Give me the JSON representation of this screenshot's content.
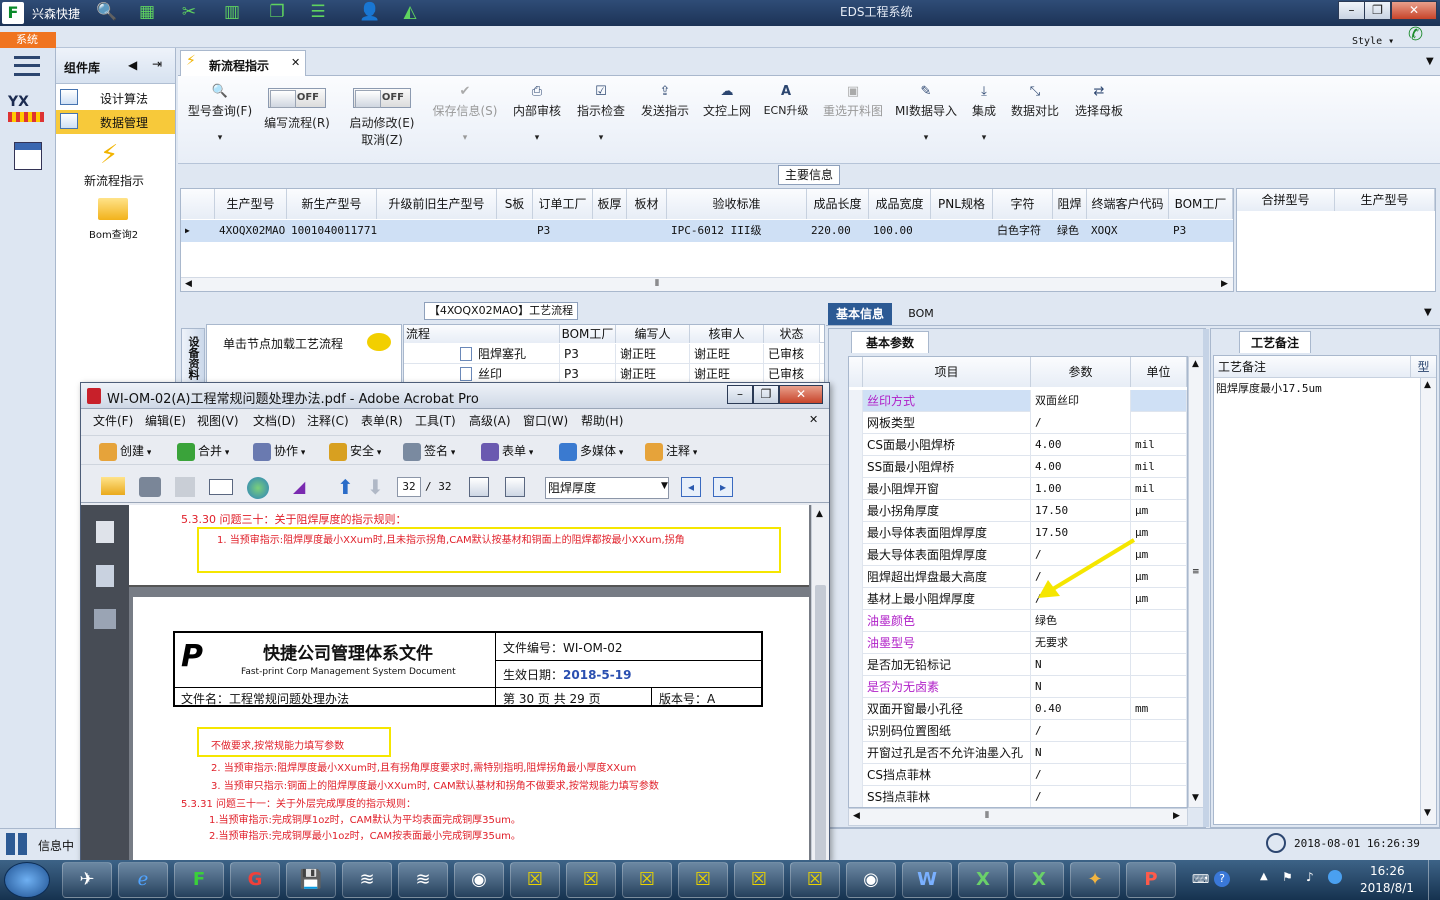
{
  "window": {
    "app_name": "兴森快捷",
    "title": "EDS工程系统",
    "style_label": "Style"
  },
  "sysbar": {
    "label": "系统"
  },
  "component_library": {
    "title": "组件库",
    "items": [
      {
        "label": "设计算法",
        "icon": "list-icon"
      },
      {
        "label": "数据管理",
        "icon": "list-icon"
      },
      {
        "label": "新流程指示",
        "icon": "lightning-icon"
      },
      {
        "label": "Bom查询2",
        "icon": "folder-icon"
      }
    ]
  },
  "tab": {
    "label": "新流程指示"
  },
  "toolbar": {
    "model_query": "型号查询(F)",
    "edit_flow": "编写流程(R)",
    "enable_modify": "启动修改(E)",
    "cancel": "取消(Z)",
    "toggle_off": "OFF",
    "save_info": "保存信息(S)",
    "internal_review": "内部审核",
    "check_instruction": "指示检查",
    "send_instruction": "发送指示",
    "upload": "文控上网",
    "ecn_upgrade": "ECN升级",
    "reselect_material": "重选开料图",
    "mi_import": "MI数据导入",
    "integrate": "集成",
    "data_compare": "数据对比",
    "select_master": "选择母板"
  },
  "main_info": {
    "title": "主要信息",
    "columns": [
      "生产型号",
      "新生产型号",
      "升级前旧生产型号",
      "S板",
      "订单工厂",
      "板厚",
      "板材",
      "验收标准",
      "成品长度",
      "成品宽度",
      "PNL规格",
      "字符",
      "阻焊",
      "终端客户代码",
      "BOM工厂"
    ],
    "row": [
      "4XOQX02MAO",
      "10010400117719",
      "",
      "",
      "P3",
      "",
      "",
      "IPC-6012 III级",
      "220.00",
      "100.00",
      "",
      "白色字符",
      "绿色",
      "XOQX",
      "P3"
    ],
    "right_columns": [
      "合拼型号",
      "生产型号"
    ]
  },
  "process": {
    "title": "【4XOQX02MAO】工艺流程",
    "hint": "单击节点加载工艺流程",
    "side_tab": "设备资料",
    "columns": [
      "流程",
      "BOM工厂",
      "编写人",
      "核审人",
      "状态"
    ],
    "rows": [
      [
        "阻焊塞孔",
        "P3",
        "谢正旺",
        "谢正旺",
        "已审核"
      ],
      [
        "丝印",
        "P3",
        "谢正旺",
        "谢正旺",
        "已审核"
      ]
    ]
  },
  "info_tabs": {
    "basic": "基本信息",
    "bom": "BOM",
    "basic_params": "基本参数"
  },
  "params": {
    "columns": [
      "项目",
      "参数",
      "单位"
    ],
    "rows": [
      {
        "item": "丝印方式",
        "value": "双面丝印",
        "unit": "",
        "color": "purple"
      },
      {
        "item": "网板类型",
        "value": "/",
        "unit": "",
        "color": ""
      },
      {
        "item": "CS面最小阻焊桥",
        "value": "4.00",
        "unit": "mil",
        "color": ""
      },
      {
        "item": "SS面最小阻焊桥",
        "value": "4.00",
        "unit": "mil",
        "color": ""
      },
      {
        "item": "最小阻焊开窗",
        "value": "1.00",
        "unit": "mil",
        "color": ""
      },
      {
        "item": "最小拐角厚度",
        "value": "17.50",
        "unit": "μm",
        "color": ""
      },
      {
        "item": "最小导体表面阻焊厚度",
        "value": "17.50",
        "unit": "μm",
        "color": ""
      },
      {
        "item": "最大导体表面阻焊厚度",
        "value": "/",
        "unit": "μm",
        "color": ""
      },
      {
        "item": "阻焊超出焊盘最大高度",
        "value": "/",
        "unit": "μm",
        "color": ""
      },
      {
        "item": "基材上最小阻焊厚度",
        "value": "/",
        "unit": "μm",
        "color": ""
      },
      {
        "item": "油墨颜色",
        "value": "绿色",
        "unit": "",
        "color": "purple"
      },
      {
        "item": "油墨型号",
        "value": "无要求",
        "unit": "",
        "color": "purple"
      },
      {
        "item": "是否加无铅标记",
        "value": "N",
        "unit": "",
        "color": ""
      },
      {
        "item": "是否为无卤素",
        "value": "N",
        "unit": "",
        "color": "purple"
      },
      {
        "item": "双面开窗最小孔径",
        "value": "0.40",
        "unit": "mm",
        "color": ""
      },
      {
        "item": "识别码位置图纸",
        "value": "/",
        "unit": "",
        "color": ""
      },
      {
        "item": "开窗过孔是否不允许油墨入孔",
        "value": "N",
        "unit": "",
        "color": ""
      },
      {
        "item": "CS挡点菲林",
        "value": "/",
        "unit": "",
        "color": ""
      },
      {
        "item": "SS挡点菲林",
        "value": "/",
        "unit": "",
        "color": ""
      }
    ]
  },
  "process_notes": {
    "tab": "工艺备注",
    "column": "工艺备注",
    "column2": "型",
    "note": "阻焊厚度最小17.5um"
  },
  "status": {
    "info_center": "信息中",
    "datetime": "2018-08-01 16:26:39"
  },
  "acrobat": {
    "title": "WI-OM-02(A)工程常规问题处理办法.pdf - Adobe Acrobat Pro",
    "menu": [
      "文件(F)",
      "编辑(E)",
      "视图(V)",
      "文档(D)",
      "注释(C)",
      "表单(R)",
      "工具(T)",
      "高级(A)",
      "窗口(W)",
      "帮助(H)"
    ],
    "tools": [
      "创建",
      "合并",
      "协作",
      "安全",
      "签名",
      "表单",
      "多媒体",
      "注释"
    ],
    "page_current": "32",
    "page_total": "/ 32",
    "search": "阻焊厚度",
    "doc": {
      "heading_1": "5.3.30 问题三十：关于阻焊厚度的指示规则：",
      "line_1": "1. 当预审指示:阻焊厚度最小XXum时,且未指示拐角,CAM默认按基材和铜面上的阻焊都按最小XXum,拐角",
      "company": "快捷公司管理体系文件",
      "company_en": "Fast-print Corp Management System Document",
      "doc_no": "文件编号：WI-OM-02",
      "eff_date_label": "生效日期：",
      "eff_date": "2018-5-19",
      "file_name": "文件名：工程常规问题处理办法",
      "page_info": "第 30 页 共 29 页",
      "version": "版本号：A",
      "line_2": "不做要求,按常规能力填写参数",
      "line_3": "2. 当预审指示:阻焊厚度最小XXum时,且有拐角厚度要求时,需特别指明,阻焊拐角最小厚度XXum",
      "line_4": "3. 当预审只指示:铜面上的阻焊厚度最小XXum时, CAM默认基材和拐角不做要求,按常规能力填写参数",
      "heading_2": "5.3.31 问题三十一：关于外层完成厚度的指示规则：",
      "line_5": "1.当预审指示:完成铜厚1oz时，CAM默认为平均表面完成铜厚35um。",
      "line_6": "2.当预审指示:完成铜厚最小1oz时，CAM按表面最小完成铜厚35um。"
    }
  },
  "taskbar": {
    "time": "16:26",
    "date": "2018/8/1"
  },
  "colors": {
    "accent": "#2c5a94",
    "purple": "#b020c8",
    "red": "#e0202a",
    "highlight": "#f5e600",
    "selected_row": "#cfe0f5"
  }
}
